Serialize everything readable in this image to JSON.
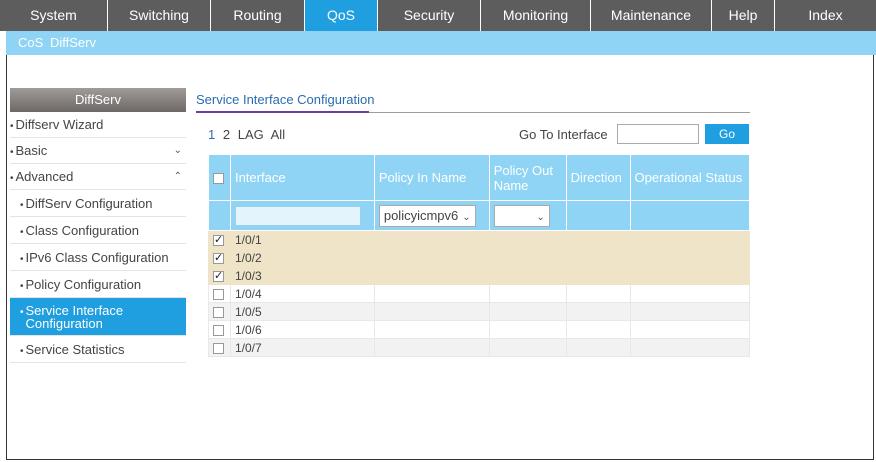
{
  "topnav": {
    "tabs": [
      {
        "label": "System",
        "active": false
      },
      {
        "label": "Switching",
        "active": false
      },
      {
        "label": "Routing",
        "active": false
      },
      {
        "label": "QoS",
        "active": true
      },
      {
        "label": "Security",
        "active": false
      },
      {
        "label": "Monitoring",
        "active": false
      },
      {
        "label": "Maintenance",
        "active": false
      },
      {
        "label": "Help",
        "active": false
      },
      {
        "label": "Index",
        "active": false
      }
    ]
  },
  "subnav": {
    "items": [
      "CoS",
      "DiffServ"
    ]
  },
  "sidebar": {
    "header": "DiffServ",
    "items": [
      {
        "label": "Diffserv Wizard"
      },
      {
        "label": "Basic",
        "chevron": "⌄"
      },
      {
        "label": "Advanced",
        "chevron": "⌃"
      },
      {
        "label": "DiffServ Configuration"
      },
      {
        "label": "Class Configuration"
      },
      {
        "label": "IPv6 Class Configuration"
      },
      {
        "label": "Policy Configuration"
      },
      {
        "label": "Service Interface Configuration"
      },
      {
        "label": "Service Statistics"
      }
    ]
  },
  "content": {
    "title": "Service Interface Configuration",
    "pager": {
      "pages": [
        "1",
        "2",
        "LAG",
        "All"
      ]
    },
    "goto": {
      "label": "Go To Interface",
      "value": "",
      "button": "Go"
    },
    "table": {
      "columns": [
        "Interface",
        "Policy In Name",
        "Policy Out Name",
        "Direction",
        "Operational Status"
      ],
      "filter": {
        "policy_in": "policyicmpv6",
        "policy_out": ""
      },
      "rows": [
        {
          "interface": "1/0/1",
          "checked": true
        },
        {
          "interface": "1/0/2",
          "checked": true
        },
        {
          "interface": "1/0/3",
          "checked": true
        },
        {
          "interface": "1/0/4",
          "checked": false
        },
        {
          "interface": "1/0/5",
          "checked": false
        },
        {
          "interface": "1/0/6",
          "checked": false
        },
        {
          "interface": "1/0/7",
          "checked": false
        }
      ]
    }
  },
  "colors": {
    "accent": "#1f9fe0",
    "nav_bg": "#5d5d5d",
    "header_bg": "#8fd4f5",
    "selected_row": "#efe3c8"
  }
}
